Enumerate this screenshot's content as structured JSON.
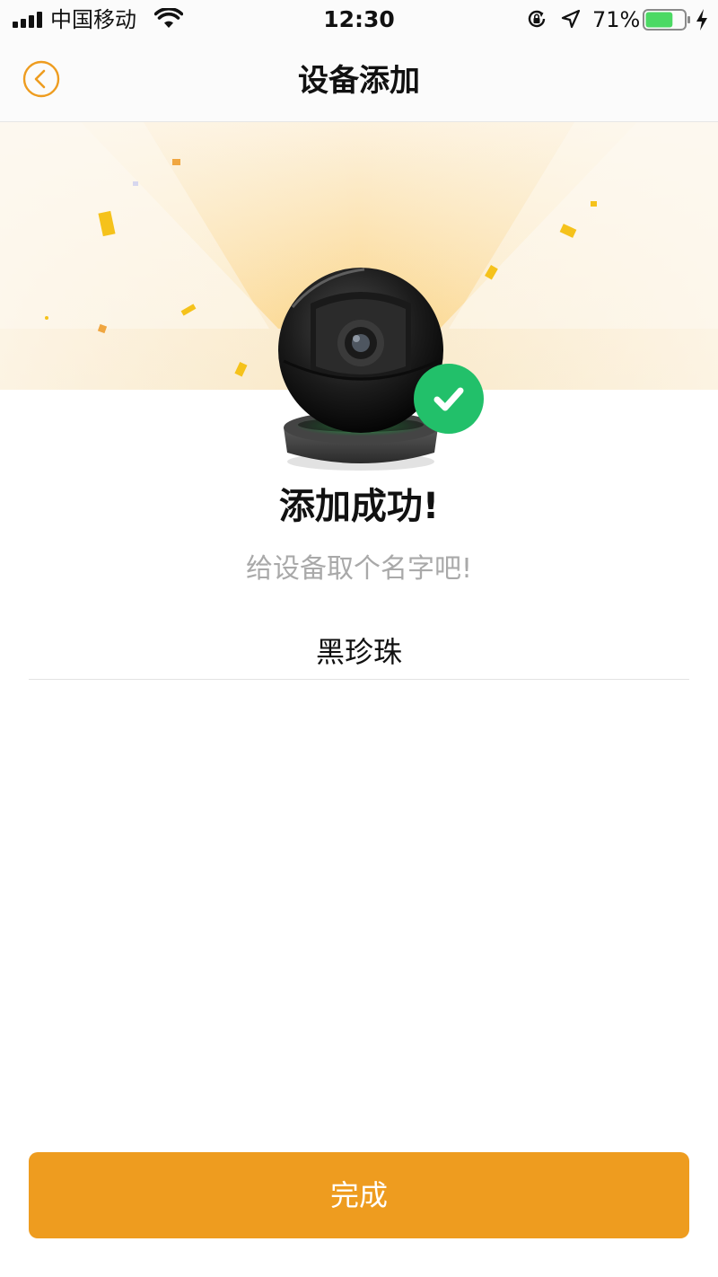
{
  "status_bar": {
    "carrier": "中国移动",
    "time": "12:30",
    "battery_percent": "71%",
    "icons": [
      "signal-icon",
      "wifi-icon",
      "orientation-lock-icon",
      "location-arrow-icon",
      "battery-icon",
      "charging-icon"
    ],
    "battery_level": 0.71,
    "battery_color": "#4cd964"
  },
  "nav": {
    "title": "设备添加",
    "back_icon": "chevron-left-icon",
    "accent_color": "#ee9c1f"
  },
  "result": {
    "title": "添加成功!",
    "hint": "给设备取个名字吧!",
    "badge_icon": "checkmark-icon",
    "badge_color": "#22c06a"
  },
  "device": {
    "name_value": "黑珍珠",
    "image_icon": "camera-image"
  },
  "footer": {
    "done_label": "完成",
    "button_color": "#ee9c1f"
  }
}
